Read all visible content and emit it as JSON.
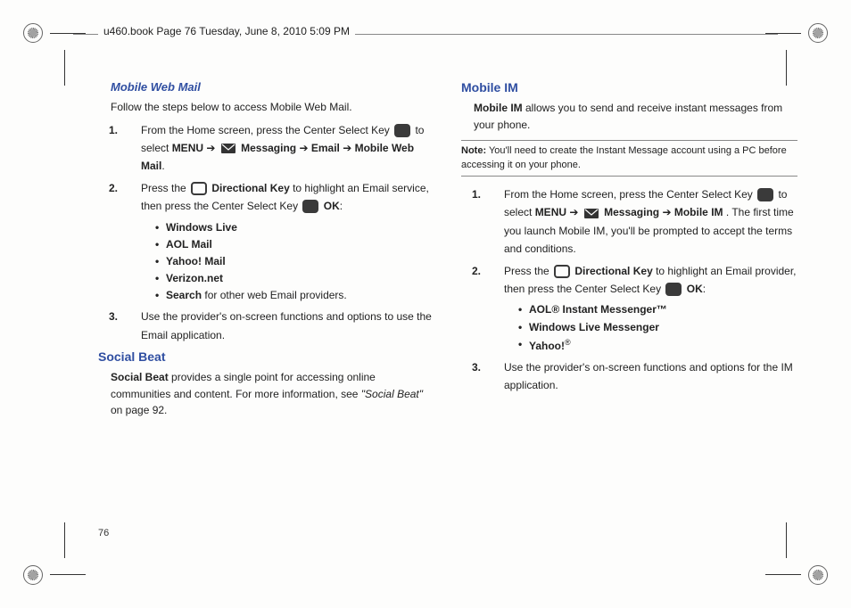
{
  "header": {
    "runningHead": "u460.book  Page 76  Tuesday, June 8, 2010  5:09 PM"
  },
  "pageNumber": "76",
  "left": {
    "sec1": {
      "title": "Mobile Web Mail",
      "intro": "Follow the steps below to access Mobile Web Mail.",
      "step1_a": "From the Home screen, press the Center Select Key ",
      "step1_b": " to select ",
      "step1_menu": "MENU",
      "step1_arrow1": " ➔ ",
      "step1_msg": " Messaging ",
      "step1_arrow2": " ➔ ",
      "step1_email": "Email",
      "step1_arrow3": " ➔ ",
      "step1_mwm": "Mobile Web Mail",
      "step1_end": ".",
      "step2_a": "Press the ",
      "step2_dirkey": "Directional Key",
      "step2_b": " to highlight an Email service, then press the Center Select Key ",
      "step2_ok": "OK",
      "step2_end": ":",
      "bullets": {
        "b1": "Windows Live",
        "b2": "AOL Mail",
        "b3": "Yahoo! Mail",
        "b4": "Verizon.net",
        "b5a": "Search",
        "b5b": " for other web Email providers."
      },
      "step3": "Use the provider's on-screen functions and options to use the Email application."
    },
    "sec2": {
      "title": "Social Beat",
      "p_a": "Social Beat",
      "p_b": " provides a single point for accessing online communities and content. For more information, see ",
      "p_c": "\"Social Beat\"",
      "p_d": " on page 92."
    }
  },
  "right": {
    "sec1": {
      "title": "Mobile IM",
      "intro_a": "Mobile IM",
      "intro_b": " allows you to send and receive instant messages from your phone.",
      "note_label": "Note:",
      "note_text": " You'll need to create the Instant Message account using a PC before accessing it on your phone.",
      "step1_a": "From the Home screen, press the Center Select Key ",
      "step1_b": " to select ",
      "step1_menu": "MENU",
      "step1_arrow1": " ➔ ",
      "step1_msg": " Messaging ",
      "step1_arrow2": " ➔ ",
      "step1_mim": "Mobile IM",
      "step1_c": ". The first time you launch Mobile IM, you'll be prompted to accept the terms and conditions.",
      "step2_a": "Press the ",
      "step2_dirkey": "Directional Key",
      "step2_b": " to highlight an Email provider, then press the Center Select Key ",
      "step2_ok": "OK",
      "step2_end": ":",
      "bullets": {
        "b1": "AOL® Instant Messenger™",
        "b2": "Windows Live Messenger",
        "b3a": "Yahoo!",
        "b3sup": "®"
      },
      "step3": "Use the provider's on-screen functions and options for the IM application."
    }
  }
}
